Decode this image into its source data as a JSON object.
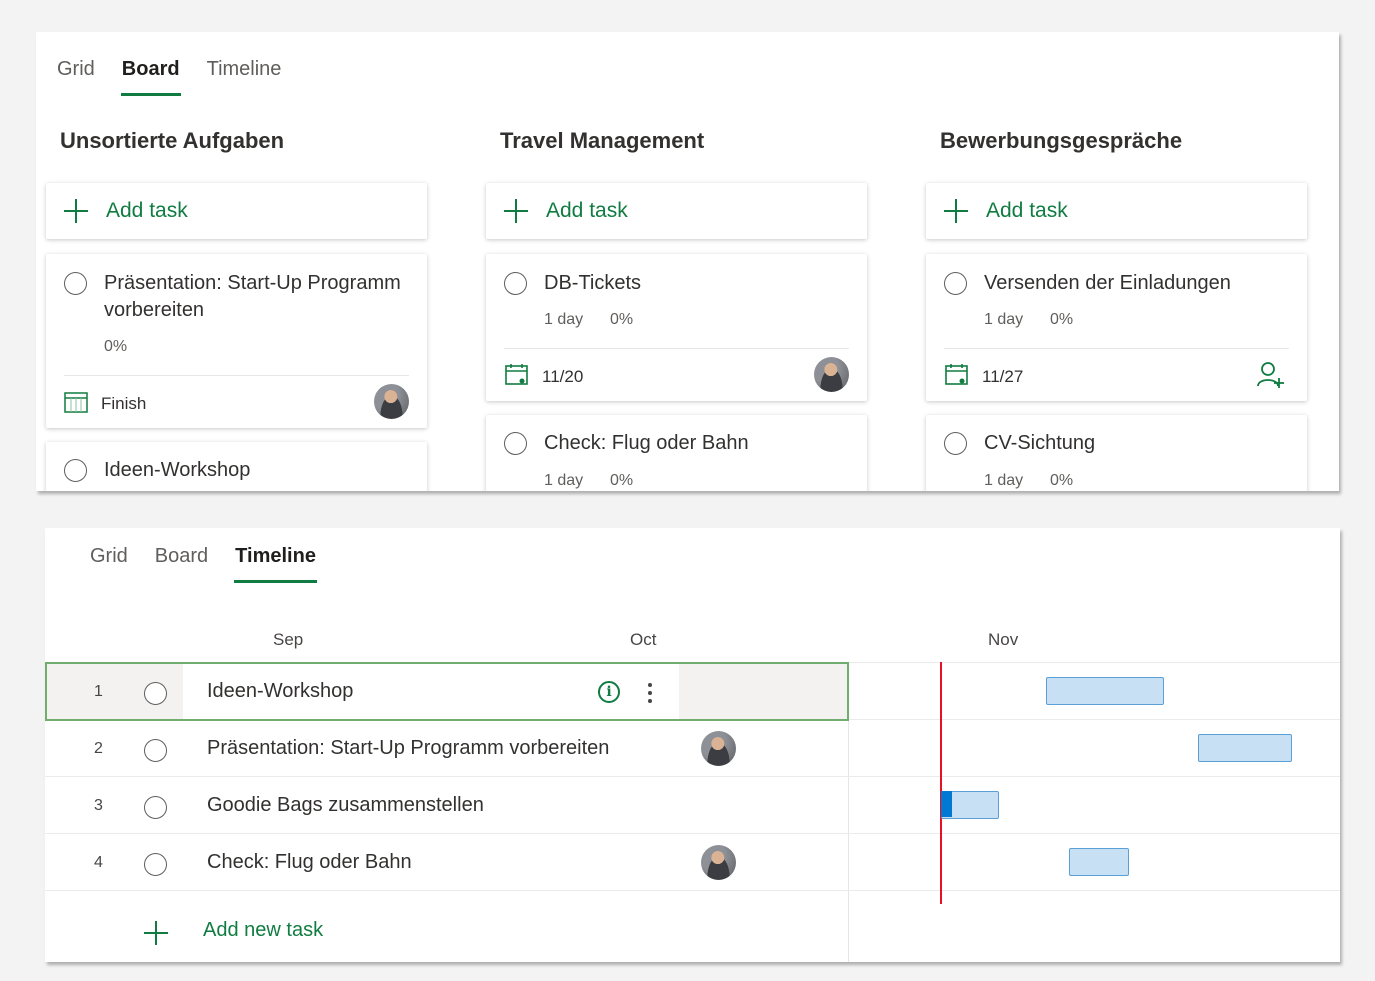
{
  "board_view": {
    "tabs": [
      {
        "label": "Grid",
        "active": false
      },
      {
        "label": "Board",
        "active": true
      },
      {
        "label": "Timeline",
        "active": false
      }
    ],
    "add_task_label": "Add task",
    "buckets": [
      {
        "title": "Unsortierte Aufgaben",
        "tasks": [
          {
            "title_line1": "Präsentation: Start-Up Programm",
            "title_line2": "vorbereiten",
            "progress": "0%",
            "footer_label": "Finish",
            "footer_icon": "planner-icon",
            "assignee": "avatar"
          },
          {
            "title": "Ideen-Workshop"
          }
        ]
      },
      {
        "title": "Travel Management",
        "tasks": [
          {
            "title": "DB-Tickets",
            "duration": "1 day",
            "progress": "0%",
            "due": "11/20",
            "footer_icon": "calendar-icon",
            "assignee": "avatar"
          },
          {
            "title": "Check: Flug oder Bahn",
            "duration": "1 day",
            "progress": "0%"
          }
        ]
      },
      {
        "title": "Bewerbungsgespräche",
        "tasks": [
          {
            "title": "Versenden der Einladungen",
            "duration": "1 day",
            "progress": "0%",
            "due": "11/27",
            "footer_icon": "calendar-icon",
            "assignee": "add-person-icon"
          },
          {
            "title": "CV-Sichtung",
            "duration": "1 day",
            "progress": "0%"
          }
        ]
      }
    ]
  },
  "timeline_view": {
    "tabs": [
      {
        "label": "Grid",
        "active": false
      },
      {
        "label": "Board",
        "active": false
      },
      {
        "label": "Timeline",
        "active": true
      }
    ],
    "months": [
      "Sep",
      "Oct",
      "Nov"
    ],
    "rows": [
      {
        "num": "1",
        "title": "Ideen-Workshop",
        "selected": true,
        "icons": [
          "info-icon",
          "more-icon"
        ]
      },
      {
        "num": "2",
        "title": "Präsentation: Start-Up Programm vorbereiten",
        "assignee": "avatar"
      },
      {
        "num": "3",
        "title": "Goodie Bags zusammenstellen"
      },
      {
        "num": "4",
        "title": "Check: Flug oder Bahn",
        "assignee": "avatar"
      }
    ],
    "add_new_task_label": "Add new task"
  },
  "colors": {
    "accent_green": "#107c41",
    "today_line": "#e81123",
    "gantt_bar_fill": "#c7e0f4",
    "gantt_bar_border": "#5aa0d6",
    "progress_fill": "#0078d4"
  }
}
